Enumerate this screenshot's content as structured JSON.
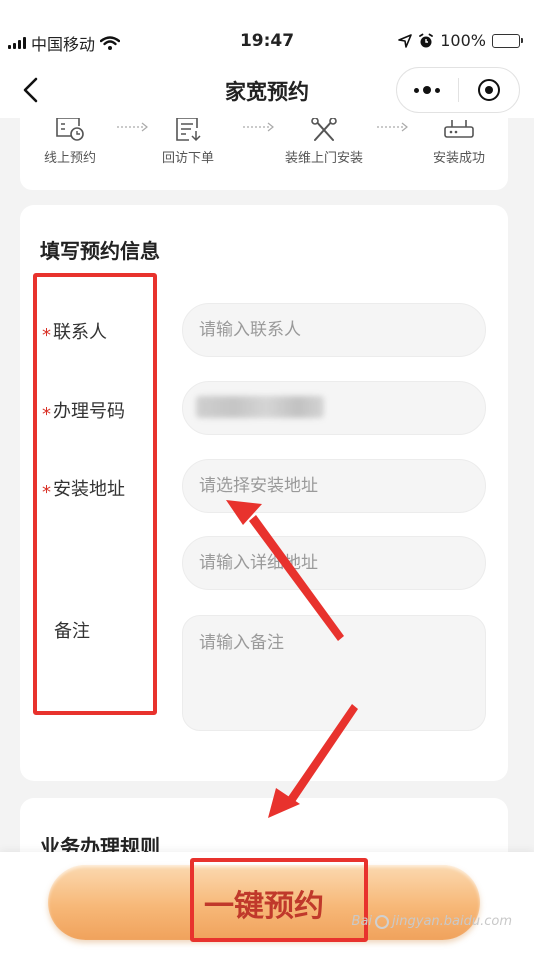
{
  "status_bar": {
    "carrier": "中国移动",
    "time": "19:47",
    "battery": "100%",
    "battery_level": 1.0,
    "icons": [
      "signal-icon",
      "wifi-icon",
      "location-icon",
      "alarm-icon",
      "battery-icon"
    ]
  },
  "nav": {
    "title": "家宽预约",
    "back_icon": "chevron-left-icon",
    "menu_icon": "more-dots-icon",
    "close_icon": "target-icon"
  },
  "steps": [
    {
      "label": "线上预约",
      "icon": "calendar-clock-icon"
    },
    {
      "label": "回访下单",
      "icon": "list-download-icon"
    },
    {
      "label": "装维上门安装",
      "icon": "tools-icon"
    },
    {
      "label": "安装成功",
      "icon": "router-icon"
    }
  ],
  "form": {
    "title": "填写预约信息",
    "required_mark": "*",
    "fields": {
      "contact": {
        "label": "联系人",
        "placeholder": "请输入联系人"
      },
      "phone": {
        "label": "办理号码",
        "value": ""
      },
      "address": {
        "label": "安装地址",
        "placeholder": "请选择安装地址"
      },
      "address_detail": {
        "placeholder": "请输入详细地址"
      },
      "remark": {
        "label": "备注",
        "placeholder": "请输入备注"
      }
    }
  },
  "rules": {
    "title": "业务办理规则"
  },
  "bottom": {
    "book_button": "一键预约"
  },
  "watermark": {
    "text": "jingyan.baidu.com"
  },
  "colors": {
    "annotation_red": "#e8322d",
    "required_red": "#d93025",
    "button_gradient_top": "#fbd9b0",
    "button_gradient_bottom": "#f0a25c",
    "button_text": "#c0392b"
  }
}
